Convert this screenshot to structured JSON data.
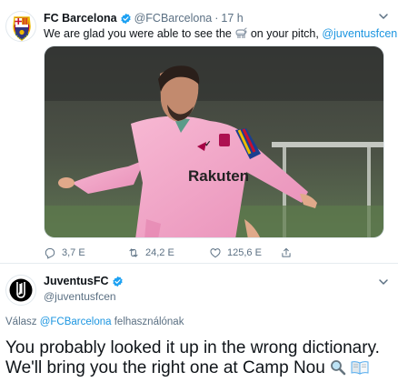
{
  "tweet1": {
    "name": "FC Barcelona",
    "handle": "@FCBarcelona",
    "separator": "·",
    "time": "17 h",
    "text_before": "We are glad you were able to see the",
    "text_middle": "on your pitch,",
    "mention": "@juventusfcen",
    "text_end": "!",
    "image_sponsor_text": "Rakuten",
    "stats": {
      "replies": "3,7 E",
      "retweets": "24,2 E",
      "likes": "125,6 E"
    }
  },
  "tweet2": {
    "name": "JuventusFC",
    "handle": "@juventusfcen",
    "reply_prefix": "Válasz",
    "reply_mention": "@FCBarcelona",
    "reply_suffix": "felhasználónak",
    "body": "You probably looked it up in the wrong dictionary. We'll bring you the right one at Camp Nou"
  },
  "colors": {
    "accent": "#1b95e0",
    "verified": "#1da1f2",
    "muted": "#5b7083",
    "jersey_pink": "#f3a6c8"
  },
  "icons": [
    "fcb-crest-icon",
    "verified-icon",
    "chevron-down-icon",
    "goat-emoji-icon",
    "wink-emoji-icon",
    "reply-icon",
    "retweet-icon",
    "like-icon",
    "share-icon",
    "juventus-logo-icon",
    "magnifier-emoji-icon",
    "book-emoji-icon"
  ]
}
